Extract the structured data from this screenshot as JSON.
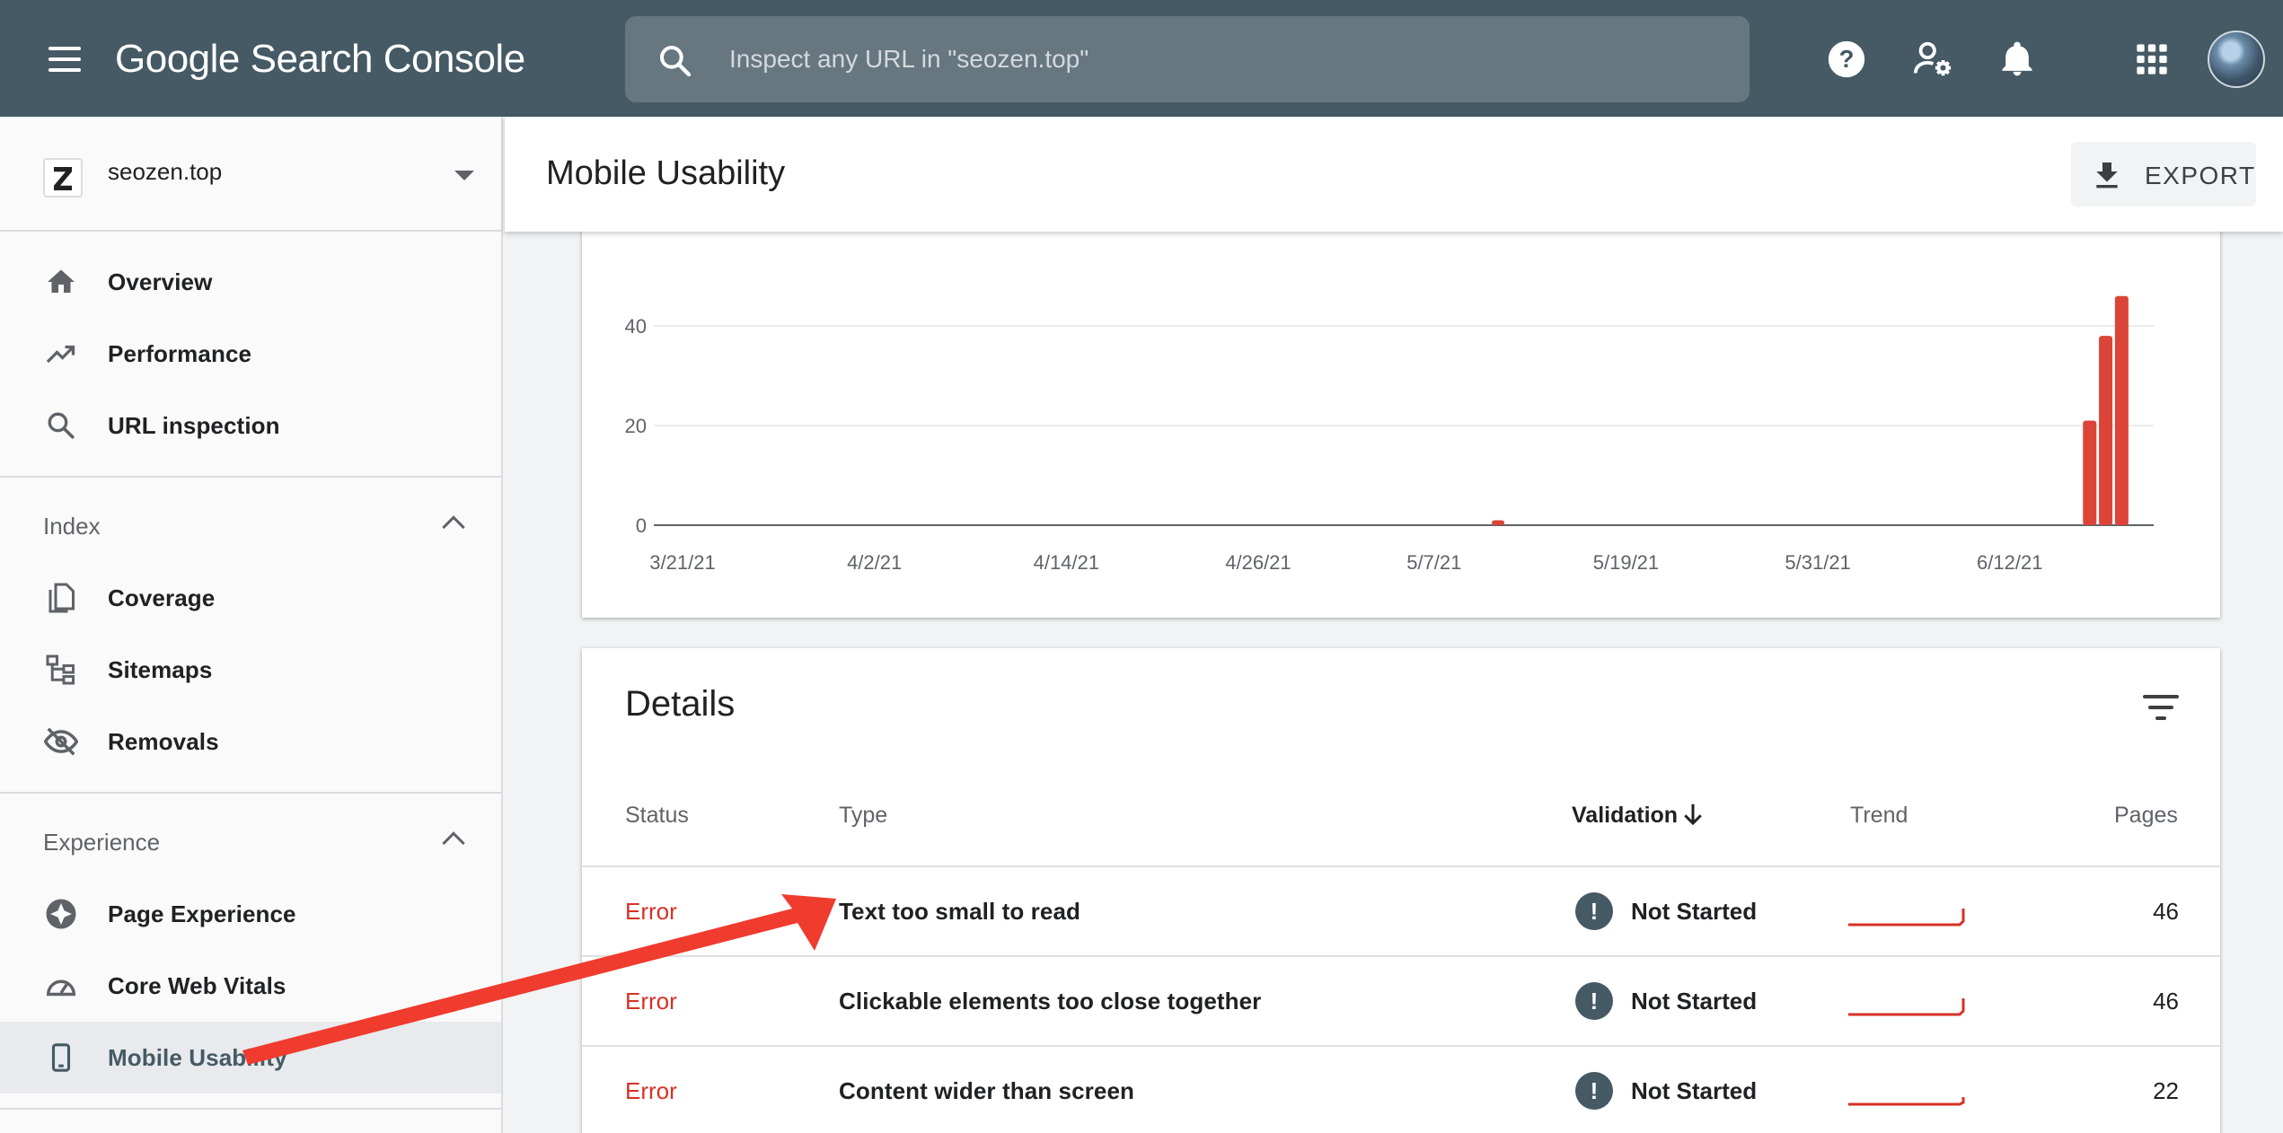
{
  "header": {
    "app_title": "Google Search Console",
    "search_placeholder": "Inspect any URL in \"seozen.top\""
  },
  "property": {
    "label": "seozen.top"
  },
  "sidebar": {
    "items": [
      {
        "label": "Overview",
        "icon": "home-icon"
      },
      {
        "label": "Performance",
        "icon": "trending-up-icon"
      },
      {
        "label": "URL inspection",
        "icon": "search-icon"
      }
    ],
    "sections": [
      {
        "title": "Index",
        "items": [
          {
            "label": "Coverage",
            "icon": "file-copy-icon"
          },
          {
            "label": "Sitemaps",
            "icon": "sitemap-icon"
          },
          {
            "label": "Removals",
            "icon": "eye-off-icon"
          }
        ]
      },
      {
        "title": "Experience",
        "items": [
          {
            "label": "Page Experience",
            "icon": "page-experience-icon"
          },
          {
            "label": "Core Web Vitals",
            "icon": "speedometer-icon"
          },
          {
            "label": "Mobile Usability",
            "icon": "phone-icon",
            "active": true
          }
        ]
      }
    ]
  },
  "page": {
    "title": "Mobile Usability",
    "export_label": "EXPORT"
  },
  "chart_data": {
    "type": "bar",
    "x_tick_labels": [
      "3/21/21",
      "4/2/21",
      "4/14/21",
      "4/26/21",
      "5/7/21",
      "5/19/21",
      "5/31/21",
      "6/12/21"
    ],
    "y_tick_labels": [
      "0",
      "20",
      "40"
    ],
    "ylim": [
      0,
      60
    ],
    "grid": true,
    "series": [
      {
        "color": "#db4437",
        "x": [
          "5/11/21",
          "6/17/21",
          "6/18/21",
          "6/19/21"
        ],
        "values": [
          1,
          21,
          38,
          46
        ]
      }
    ]
  },
  "details": {
    "title": "Details",
    "columns": {
      "status": "Status",
      "type": "Type",
      "validation": "Validation",
      "trend": "Trend",
      "pages": "Pages"
    },
    "rows": [
      {
        "status": "Error",
        "type": "Text too small to read",
        "validation": "Not Started",
        "pages": "46"
      },
      {
        "status": "Error",
        "type": "Clickable elements too close together",
        "validation": "Not Started",
        "pages": "46"
      },
      {
        "status": "Error",
        "type": "Content wider than screen",
        "validation": "Not Started",
        "pages": "22"
      }
    ]
  },
  "colors": {
    "header_bg": "#455a64",
    "error": "#d93025",
    "bar": "#db4437",
    "annotation_arrow": "#f03b2f"
  }
}
